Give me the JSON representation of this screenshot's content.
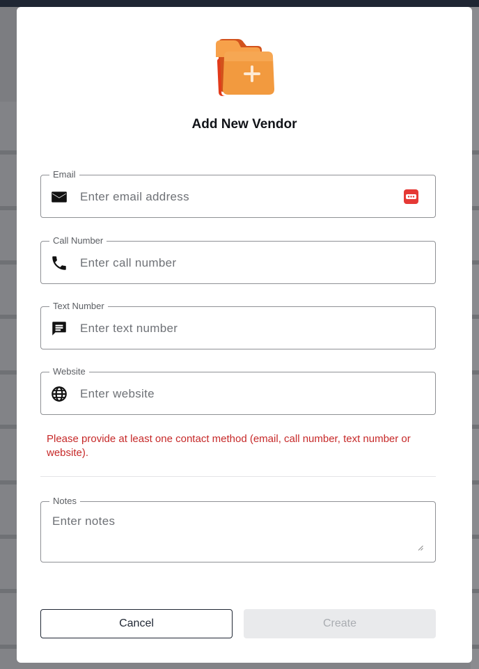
{
  "dialog": {
    "title": "Add New Vendor",
    "hero_icon": "folder-add-icon"
  },
  "fields": {
    "email": {
      "label": "Email",
      "placeholder": "Enter email address",
      "icon": "mail-icon",
      "badge": "password-manager-icon"
    },
    "call": {
      "label": "Call Number",
      "placeholder": "Enter call number",
      "icon": "phone-icon"
    },
    "text": {
      "label": "Text Number",
      "placeholder": "Enter text number",
      "icon": "message-icon"
    },
    "website": {
      "label": "Website",
      "placeholder": "Enter website",
      "icon": "globe-icon"
    },
    "notes": {
      "label": "Notes",
      "placeholder": "Enter notes"
    }
  },
  "error_message": "Please provide at least one contact method (email, call number, text number or website).",
  "actions": {
    "cancel_label": "Cancel",
    "create_label": "Create"
  },
  "colors": {
    "error": "#c62828",
    "primary_dark": "#1f2633",
    "disabled_bg": "#e9eaec",
    "folder_orange": "#f0943a"
  }
}
